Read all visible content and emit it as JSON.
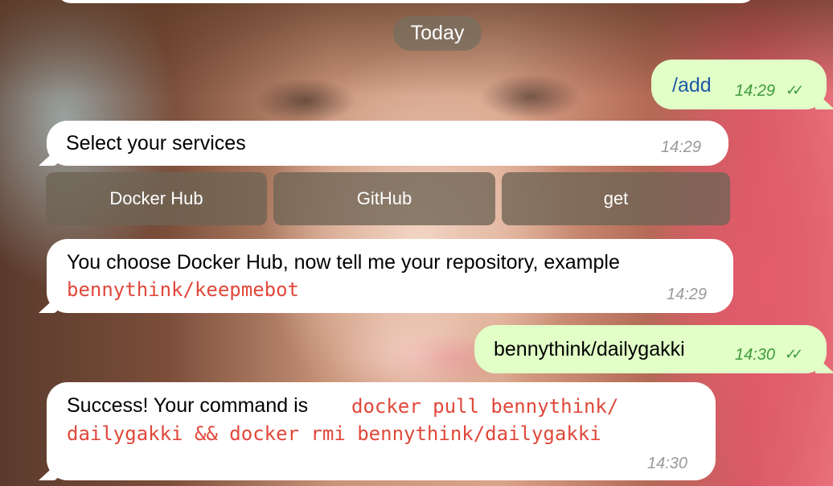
{
  "chat": {
    "date_separator": "Today",
    "messages": [
      {
        "id": "m1",
        "direction": "outgoing",
        "text": "/add",
        "time": "14:29",
        "status": "read"
      },
      {
        "id": "m2",
        "direction": "incoming",
        "text": "Select your services",
        "time": "14:29"
      },
      {
        "id": "m3",
        "direction": "incoming",
        "text": "You choose Docker Hub, now tell me your repository, example",
        "code": "bennythink/keepmebot",
        "time": "14:29"
      },
      {
        "id": "m4",
        "direction": "outgoing",
        "text": "bennythink/dailygakki",
        "time": "14:30",
        "status": "read"
      },
      {
        "id": "m5",
        "direction": "incoming",
        "text": "Success! Your command is",
        "code_line1": "docker pull bennythink/",
        "code_line2": "dailygakki && docker rmi bennythink/dailygakki",
        "time": "14:30"
      }
    ],
    "inline_keyboard": [
      "Docker Hub",
      "GitHub",
      "get"
    ],
    "read_ticks": "✓✓"
  },
  "colors": {
    "outgoing_bubble": "#e1ffc7",
    "incoming_bubble": "#ffffff",
    "code_text": "#e0483a",
    "outgoing_time": "#3e9a3e",
    "command_text": "#1f5aa6"
  }
}
